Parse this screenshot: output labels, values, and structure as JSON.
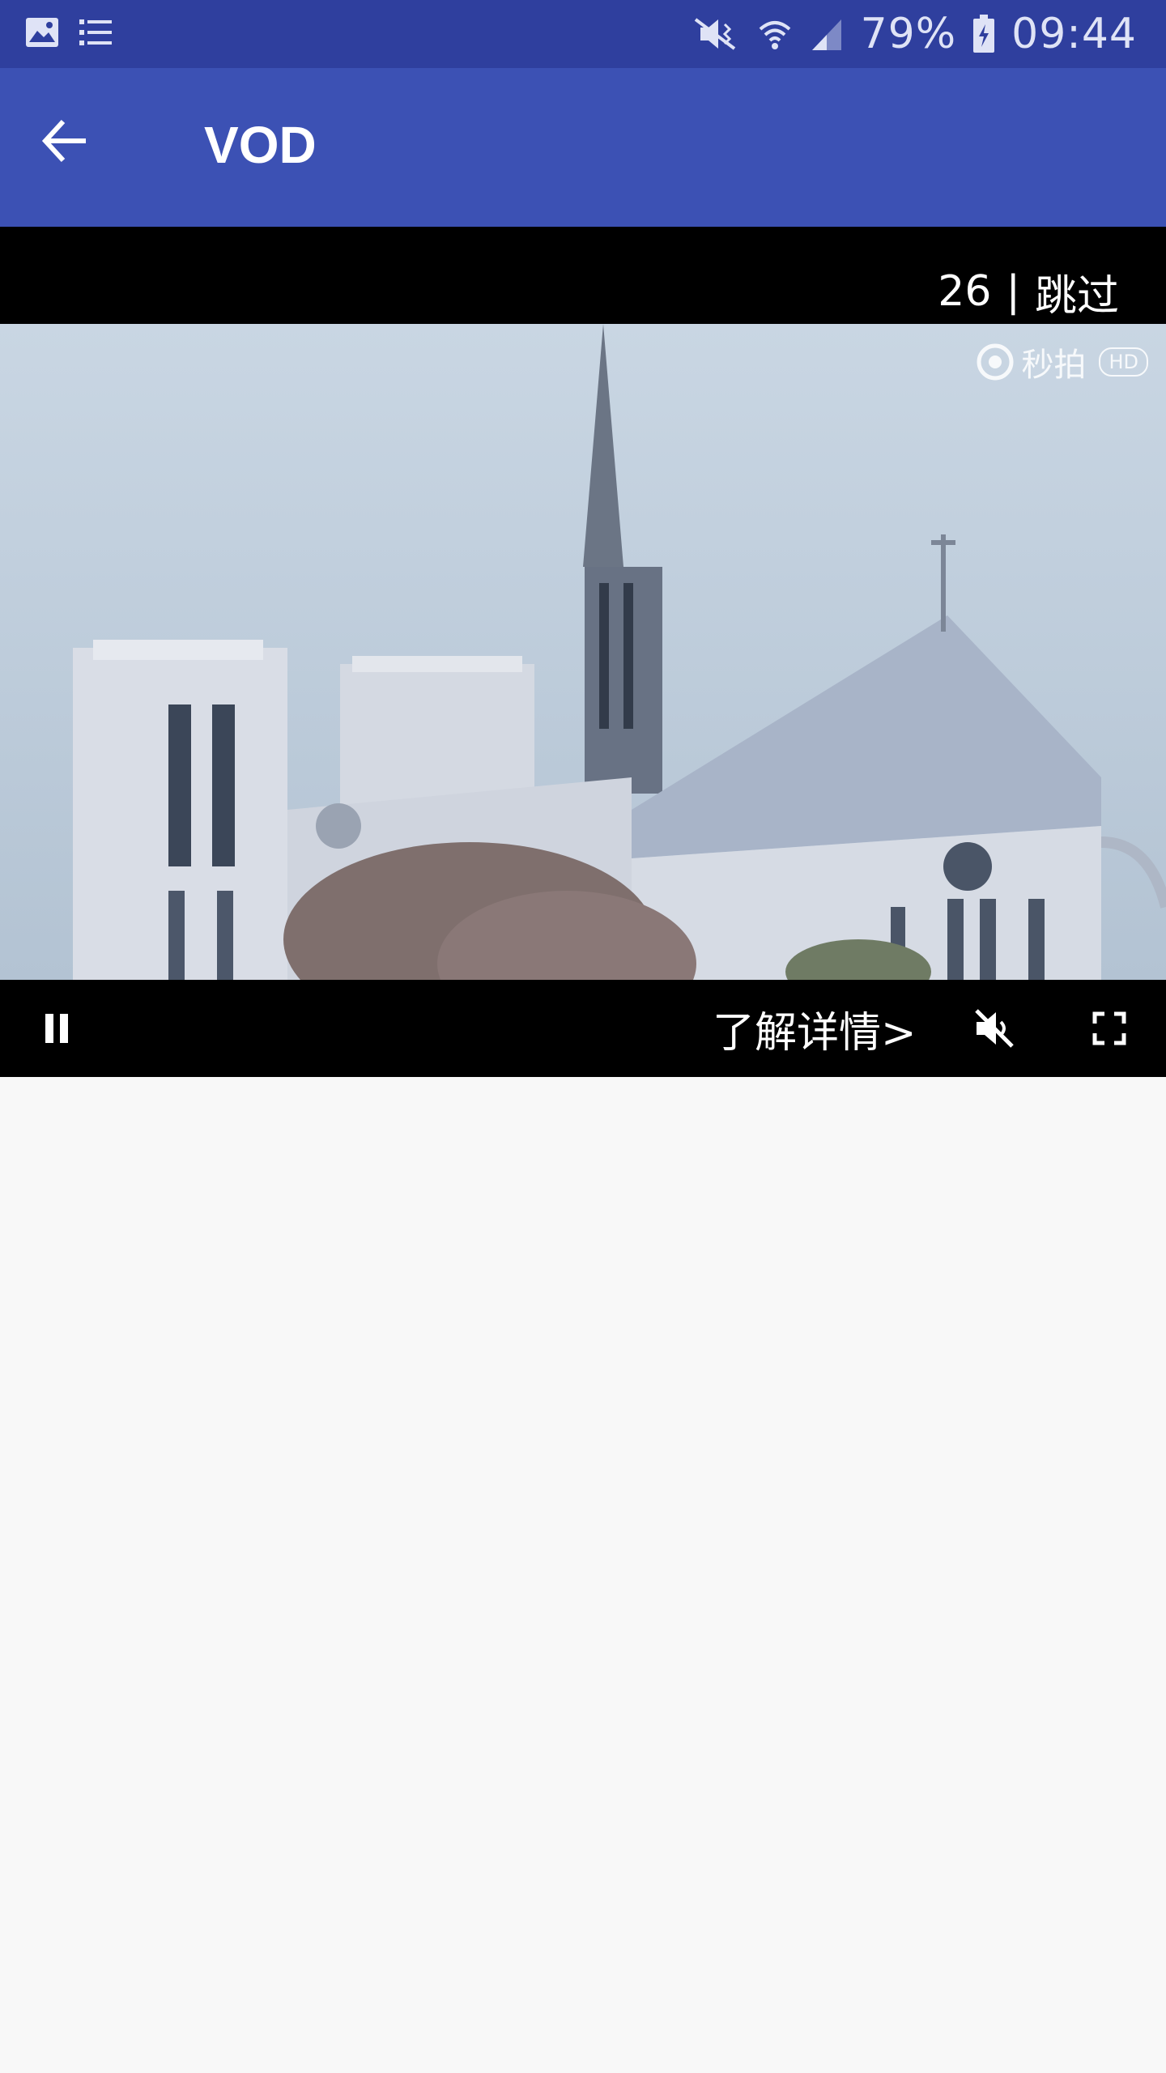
{
  "status_bar": {
    "battery_percent": "79%",
    "time": "09:44",
    "icons": [
      "gallery-icon",
      "list-icon",
      "mute-icon",
      "wifi-icon",
      "signal-icon",
      "battery-icon"
    ]
  },
  "app_bar": {
    "title": "VOD",
    "back_icon": "arrow-back-icon",
    "background": "#3c51b4"
  },
  "player": {
    "skip": {
      "countdown": "26",
      "separator": "|",
      "label": "跳过"
    },
    "watermark": {
      "brand": "秒拍",
      "badge": "HD"
    },
    "controls": {
      "details_label": "了解详情>",
      "pause_icon": "pause-icon",
      "mute_icon": "volume-off-icon",
      "fullscreen_icon": "fullscreen-icon"
    }
  }
}
